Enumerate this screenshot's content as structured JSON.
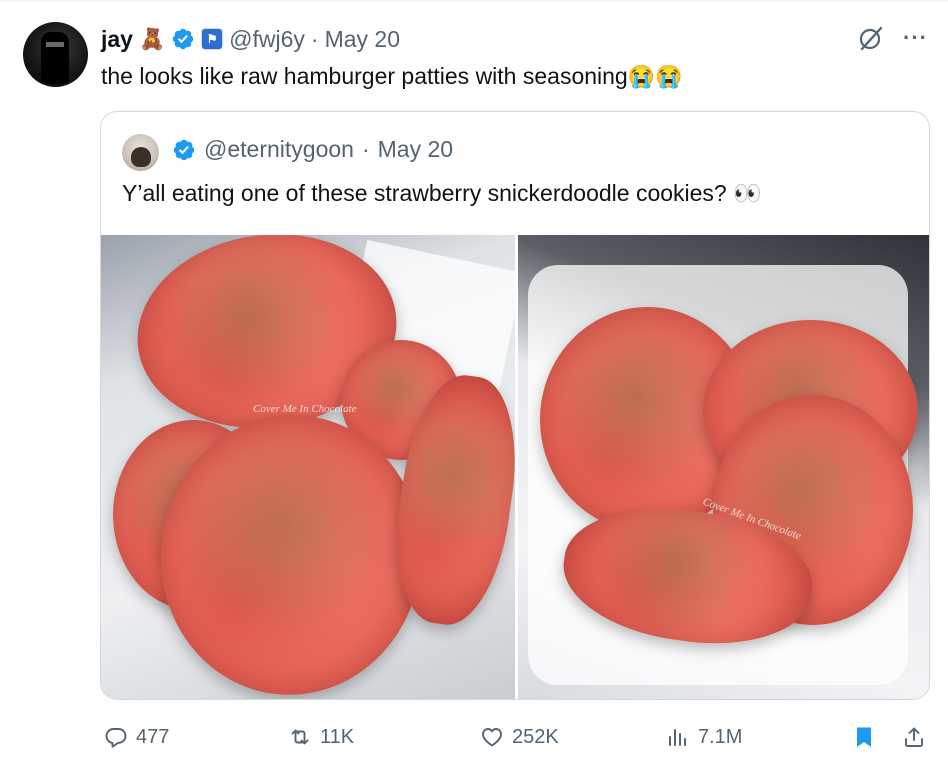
{
  "tweet": {
    "name": "jay",
    "name_emoji": "🧸",
    "handle": "@fwj6y",
    "separator": "·",
    "date": "May 20",
    "text": "the looks like raw hamburger patties with seasoning",
    "text_emojis": "😭😭",
    "colors": {
      "verified": "#1d9bf0",
      "secondary_text": "#536471",
      "bookmark": "#1d9bf0"
    }
  },
  "quote": {
    "handle": "@eternitygoon",
    "separator": "·",
    "date": "May 20",
    "text": "Y’all eating one of these strawberry snickerdoodle cookies? 👀",
    "watermark_left": "Cover Me In Chocolate",
    "watermark_right": "Cover Me In Chocolate"
  },
  "actions": {
    "replies": "477",
    "reposts": "11K",
    "likes": "252K",
    "views": "7.1M",
    "icons": [
      "reply-icon",
      "repost-icon",
      "like-icon",
      "views-icon",
      "bookmark-icon",
      "share-icon"
    ]
  }
}
